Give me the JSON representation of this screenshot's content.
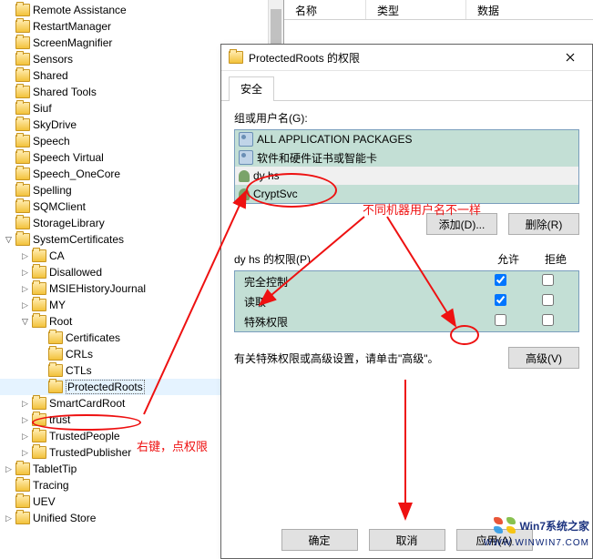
{
  "right_header": {
    "name": "名称",
    "type": "类型",
    "data": "数据"
  },
  "tree": [
    {
      "indent": 0,
      "exp": "none",
      "label": "Remote Assistance"
    },
    {
      "indent": 0,
      "exp": "none",
      "label": "RestartManager"
    },
    {
      "indent": 0,
      "exp": "none",
      "label": "ScreenMagnifier"
    },
    {
      "indent": 0,
      "exp": "none",
      "label": "Sensors"
    },
    {
      "indent": 0,
      "exp": "none",
      "label": "Shared"
    },
    {
      "indent": 0,
      "exp": "none",
      "label": "Shared Tools"
    },
    {
      "indent": 0,
      "exp": "none",
      "label": "Siuf"
    },
    {
      "indent": 0,
      "exp": "none",
      "label": "SkyDrive"
    },
    {
      "indent": 0,
      "exp": "none",
      "label": "Speech"
    },
    {
      "indent": 0,
      "exp": "none",
      "label": "Speech Virtual"
    },
    {
      "indent": 0,
      "exp": "none",
      "label": "Speech_OneCore"
    },
    {
      "indent": 0,
      "exp": "none",
      "label": "Spelling"
    },
    {
      "indent": 0,
      "exp": "none",
      "label": "SQMClient"
    },
    {
      "indent": 0,
      "exp": "none",
      "label": "StorageLibrary"
    },
    {
      "indent": 0,
      "exp": "expanded",
      "label": "SystemCertificates"
    },
    {
      "indent": 1,
      "exp": "collapsed",
      "label": "CA"
    },
    {
      "indent": 1,
      "exp": "collapsed",
      "label": "Disallowed"
    },
    {
      "indent": 1,
      "exp": "collapsed",
      "label": "MSIEHistoryJournal"
    },
    {
      "indent": 1,
      "exp": "collapsed",
      "label": "MY"
    },
    {
      "indent": 1,
      "exp": "expanded",
      "label": "Root"
    },
    {
      "indent": 2,
      "exp": "none",
      "label": "Certificates"
    },
    {
      "indent": 2,
      "exp": "none",
      "label": "CRLs"
    },
    {
      "indent": 2,
      "exp": "none",
      "label": "CTLs"
    },
    {
      "indent": 2,
      "exp": "none",
      "label": "ProtectedRoots",
      "selected": true
    },
    {
      "indent": 1,
      "exp": "collapsed",
      "label": "SmartCardRoot"
    },
    {
      "indent": 1,
      "exp": "collapsed",
      "label": "trust"
    },
    {
      "indent": 1,
      "exp": "collapsed",
      "label": "TrustedPeople"
    },
    {
      "indent": 1,
      "exp": "collapsed",
      "label": "TrustedPublisher"
    },
    {
      "indent": 0,
      "exp": "collapsed",
      "label": "TabletTip"
    },
    {
      "indent": 0,
      "exp": "none",
      "label": "Tracing"
    },
    {
      "indent": 0,
      "exp": "none",
      "label": "UEV"
    },
    {
      "indent": 0,
      "exp": "collapsed",
      "label": "Unified Store"
    }
  ],
  "dialog": {
    "title": "ProtectedRoots 的权限",
    "tab_security": "安全",
    "group_label": "组或用户名(G):",
    "principals": [
      {
        "icon": "users",
        "name": "ALL APPLICATION PACKAGES"
      },
      {
        "icon": "users",
        "name": "软件和硬件证书或智能卡"
      },
      {
        "icon": "person",
        "name": "dy hs",
        "sel": true
      },
      {
        "icon": "person",
        "name": "CryptSvc"
      }
    ],
    "btn_add": "添加(D)...",
    "btn_remove": "删除(R)",
    "perm_label": "dy hs 的权限(P)",
    "col_allow": "允许",
    "col_deny": "拒绝",
    "perms": [
      {
        "name": "完全控制",
        "allow": true,
        "deny": false
      },
      {
        "name": "读取",
        "allow": true,
        "deny": false
      },
      {
        "name": "特殊权限",
        "allow": false,
        "deny": false
      }
    ],
    "advanced_text": "有关特殊权限或高级设置，请单击\"高级\"。",
    "btn_advanced": "高级(V)",
    "btn_ok": "确定",
    "btn_cancel": "取消",
    "btn_apply": "应用(A)"
  },
  "annotations": {
    "right_click": "右键，点权限",
    "diff_user": "不同机器用户名不一样"
  },
  "watermark": {
    "brand": "Win7系统之家",
    "url": "WWW.WINWIN7.COM"
  }
}
